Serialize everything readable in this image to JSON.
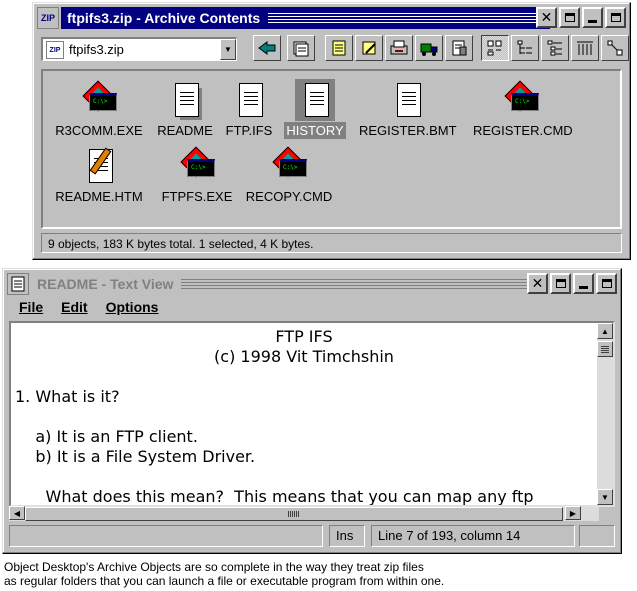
{
  "archive": {
    "title": "ftpifs3.zip - Archive Contents",
    "sys_icon_text": "ZIP",
    "path_value": "ftpifs3.zip",
    "files": [
      {
        "name": "R3COMM.EXE",
        "type": "exe",
        "selected": false
      },
      {
        "name": "README",
        "type": "doc-hatched",
        "selected": false
      },
      {
        "name": "FTP.IFS",
        "type": "doc",
        "selected": false
      },
      {
        "name": "HISTORY",
        "type": "doc",
        "selected": true
      },
      {
        "name": "REGISTER.BMT",
        "type": "doc",
        "selected": false
      },
      {
        "name": "REGISTER.CMD",
        "type": "exe",
        "selected": false
      },
      {
        "name": "README.HTM",
        "type": "htm",
        "selected": false
      },
      {
        "name": "FTPFS.EXE",
        "type": "exe",
        "selected": false
      },
      {
        "name": "RECOPY.CMD",
        "type": "exe",
        "selected": false
      }
    ],
    "status": "9 objects, 183 K bytes total.  1 selected, 4 K bytes."
  },
  "textview": {
    "title": "README - Text View",
    "menu": [
      {
        "label": "File"
      },
      {
        "label": "Edit"
      },
      {
        "label": "Options"
      }
    ],
    "lines": [
      {
        "text": "FTP IFS",
        "center": true
      },
      {
        "text": "(c) 1998 Vit Timchshin",
        "center": true
      },
      {
        "text": "",
        "center": false
      },
      {
        "text": "1. What is it?",
        "center": false
      },
      {
        "text": "",
        "center": false
      },
      {
        "text": "    a) It is an FTP client.",
        "center": false
      },
      {
        "text": "    b) It is a File System Driver.",
        "center": false
      },
      {
        "text": "",
        "center": false
      },
      {
        "text": "      What does this mean?  This means that you can map any ftp",
        "center": false
      }
    ],
    "status_ins": "Ins",
    "status_pos": "Line 7 of 193, column 14"
  },
  "caption": {
    "line1": "Object Desktop's Archive Objects are so complete in the way they treat zip files",
    "line2": "as regular folders that you can launch a file or executable program from within one."
  },
  "colors": {
    "title_active": "#000080",
    "window_face": "#c0c0c0",
    "selection": "#808080"
  }
}
